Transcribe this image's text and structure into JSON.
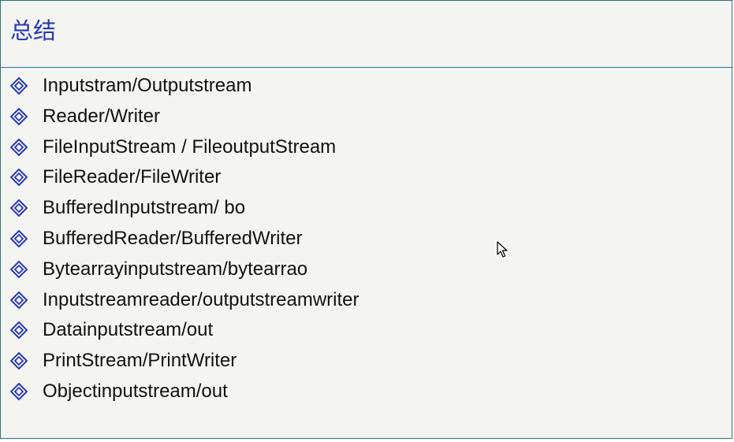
{
  "slide": {
    "title": "总结",
    "bullet_icon": "diamond-bullet-icon",
    "items": [
      "Inputstram/Outputstream",
      "Reader/Writer",
      "FileInputStream / FileoutputStream",
      "FileReader/FileWriter",
      "BufferedInputstream/ bo",
      "BufferedReader/BufferedWriter",
      "Bytearrayinputstream/bytearrao",
      "Inputstreamreader/outputstreamwriter",
      "Datainputstream/out",
      "PrintStream/PrintWriter",
      "Objectinputstream/out"
    ]
  },
  "colors": {
    "title": "#2a3aa8",
    "bullet": "#2a3aa8",
    "border": "#2f6f7e",
    "background": "#f4f4f2"
  }
}
